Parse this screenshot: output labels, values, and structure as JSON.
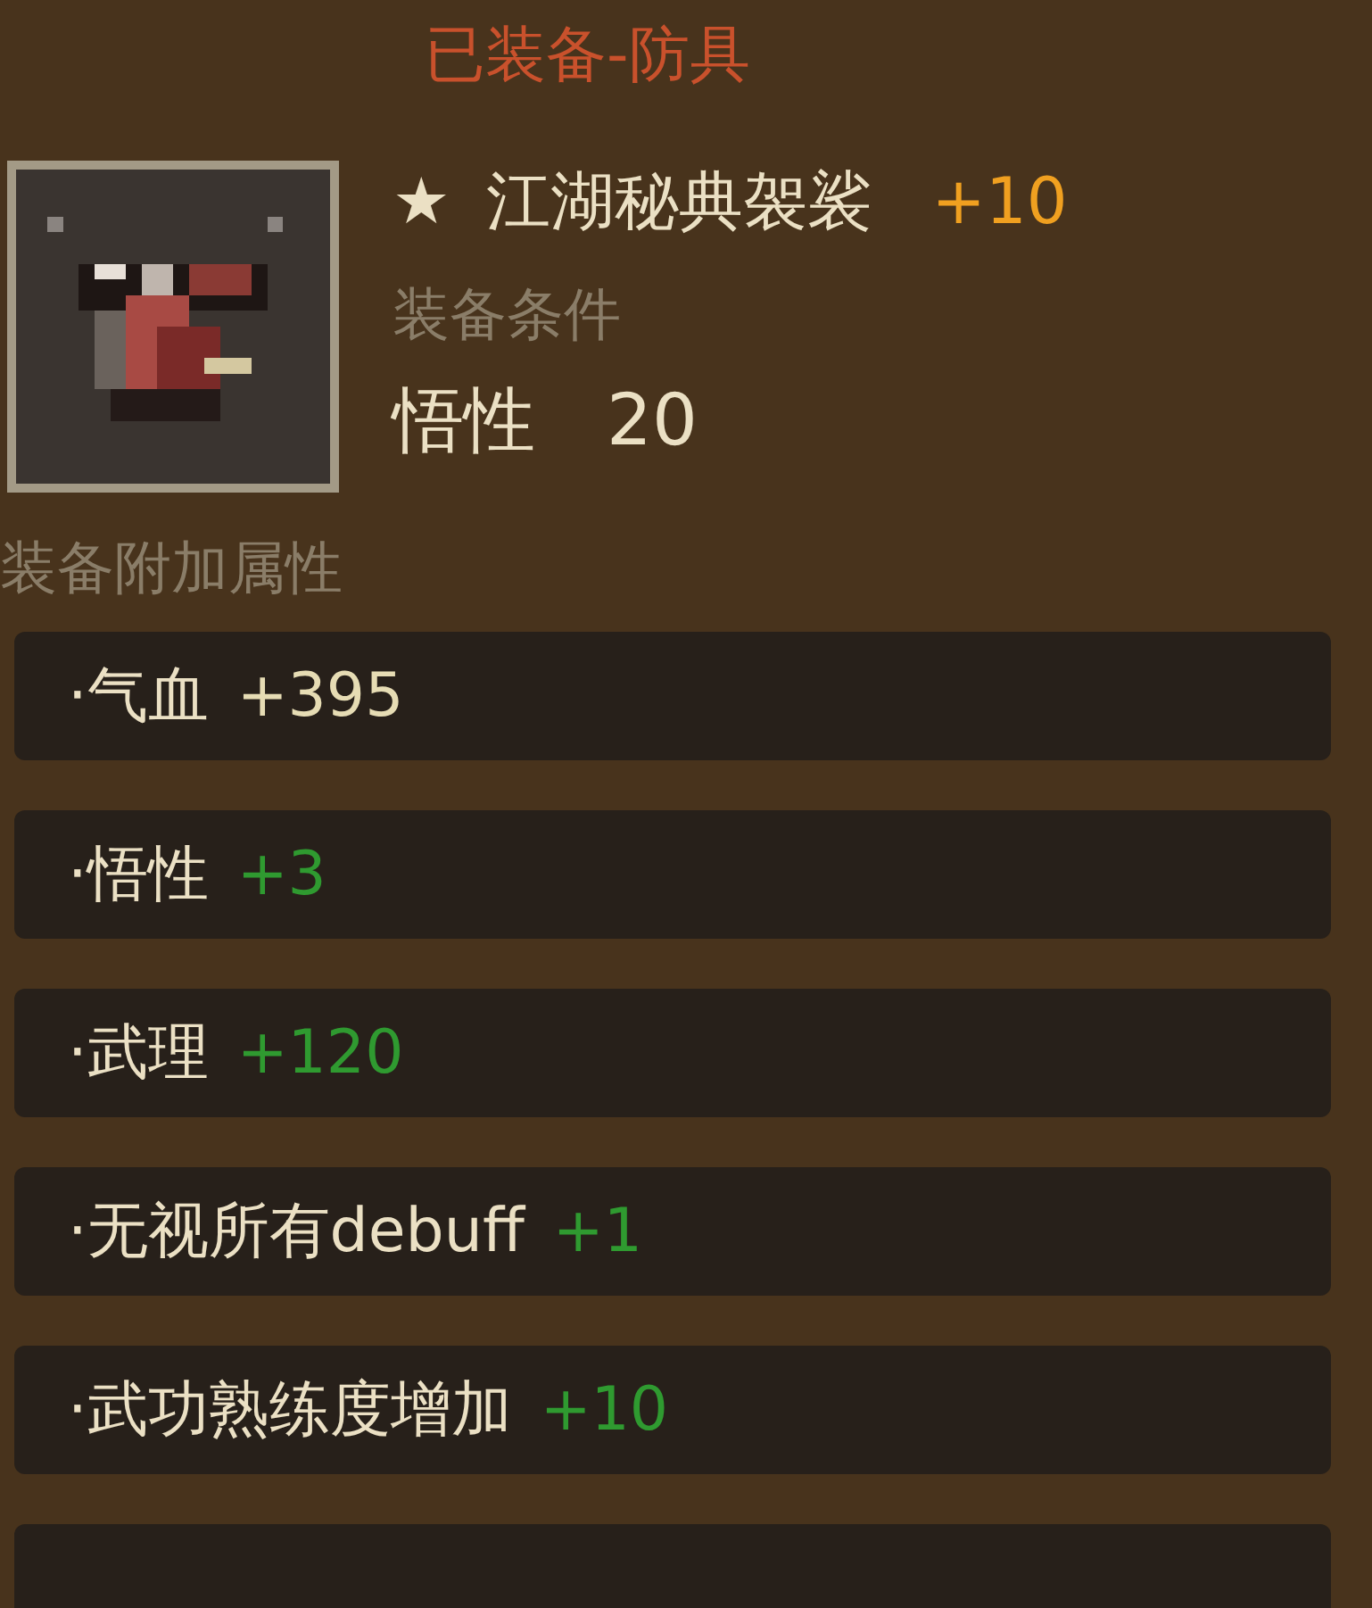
{
  "header": {
    "title": "已装备-防具"
  },
  "item": {
    "star": "★",
    "name": "江湖秘典袈裟",
    "enhance": "+10",
    "requirement_label": "装备条件",
    "requirement": {
      "stat": "悟性",
      "value": "20"
    }
  },
  "bonus_section": {
    "title": "装备附加属性"
  },
  "stats": [
    {
      "label": "·气血",
      "value": "+395",
      "color": "#e6dcb4"
    },
    {
      "label": "·悟性",
      "value": "+3",
      "color": "#2f9a30"
    },
    {
      "label": "·武理",
      "value": "+120",
      "color": "#2f9a30"
    },
    {
      "label": "·无视所有debuff",
      "value": "+1",
      "color": "#2f9a30"
    },
    {
      "label": "·武功熟练度增加",
      "value": "+10",
      "color": "#2f9a30"
    }
  ]
}
